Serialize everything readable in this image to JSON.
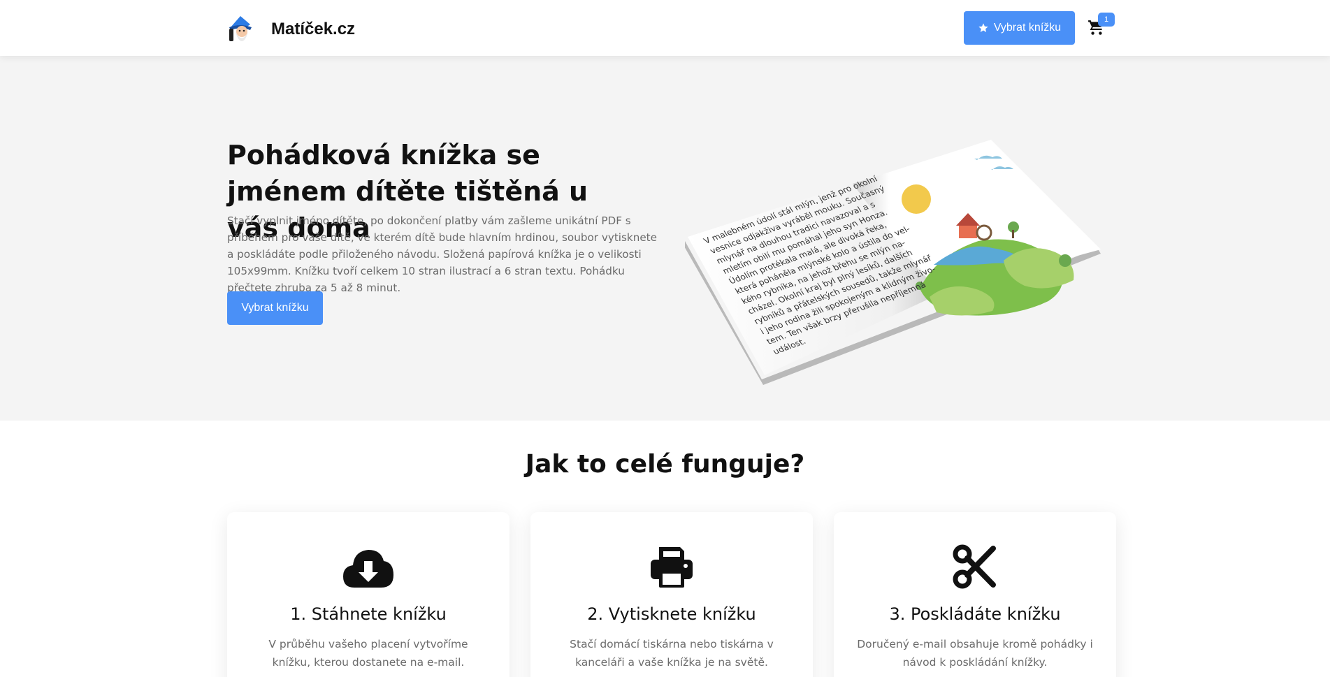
{
  "header": {
    "brand": "Matíček.cz",
    "cta_label": "Vybrat knížku",
    "cart_count": "1",
    "icons": {
      "logo": "wizard-logo-icon",
      "cta": "star-icon",
      "cart": "cart-icon"
    }
  },
  "hero": {
    "title": "Pohádková knížka se jménem dítěte tištěná u vás doma",
    "text": "Stačí vyplnit jméno dítěte, po dokončení platby vám zašleme unikátní PDF s příběhem pro vaše dítě, ve kterém dítě bude hlavním hrdinou, soubor vytisknete a poskládáte podle přiloženého návodu. Složená papírová knížka je o velikosti 105x99mm. Knížku tvoří celkem 10 stran ilustrací a 6 stran textu. Pohádku přečtete zhruba za 5 až 8 minut.",
    "button_label": "Vybrat knížku",
    "book_lines": [
      "V malebném údolí stál mlýn, jenž pro okolní",
      "vesnice odjakživa vyráběl mouku. Současný",
      "mlynář na dlouhou tradici navazoval a s",
      "mletím obilí mu pomáhal jeho syn Honza.",
      "Údolím protékala malá, ale divoká řeka,",
      "která poháněla mlýnské kolo a ústila do vel-",
      "kého rybníka, na jehož břehu se mlýn na-",
      "cházel. Okolní kraj byl plný lesíků, dalších",
      "rybníků a přátelských sousedů, takže mlynář",
      "i jeho rodina žili spokojeným a klidným živo-",
      "tem. Ten však brzy přerušila nepříjemná",
      "událost."
    ]
  },
  "how": {
    "title": "Jak to celé funguje?",
    "steps": [
      {
        "icon": "cloud-download-icon",
        "title": "1. Stáhnete knížku",
        "text": "V průběhu vašeho placení vytvoříme knížku, kterou dostanete na e-mail."
      },
      {
        "icon": "printer-icon",
        "title": "2. Vytisknete knížku",
        "text": "Stačí domácí tiskárna nebo tiskárna v kanceláři a vaše knížka je na světě."
      },
      {
        "icon": "scissors-icon",
        "title": "3. Poskládáte knížku",
        "text": "Doručený e-mail obsahuje kromě pohádky i návod k poskládání knížky."
      }
    ]
  },
  "colors": {
    "accent": "#4a90f7",
    "hero_bg": "#f4f4f4",
    "muted_text": "#6b6b6b"
  }
}
